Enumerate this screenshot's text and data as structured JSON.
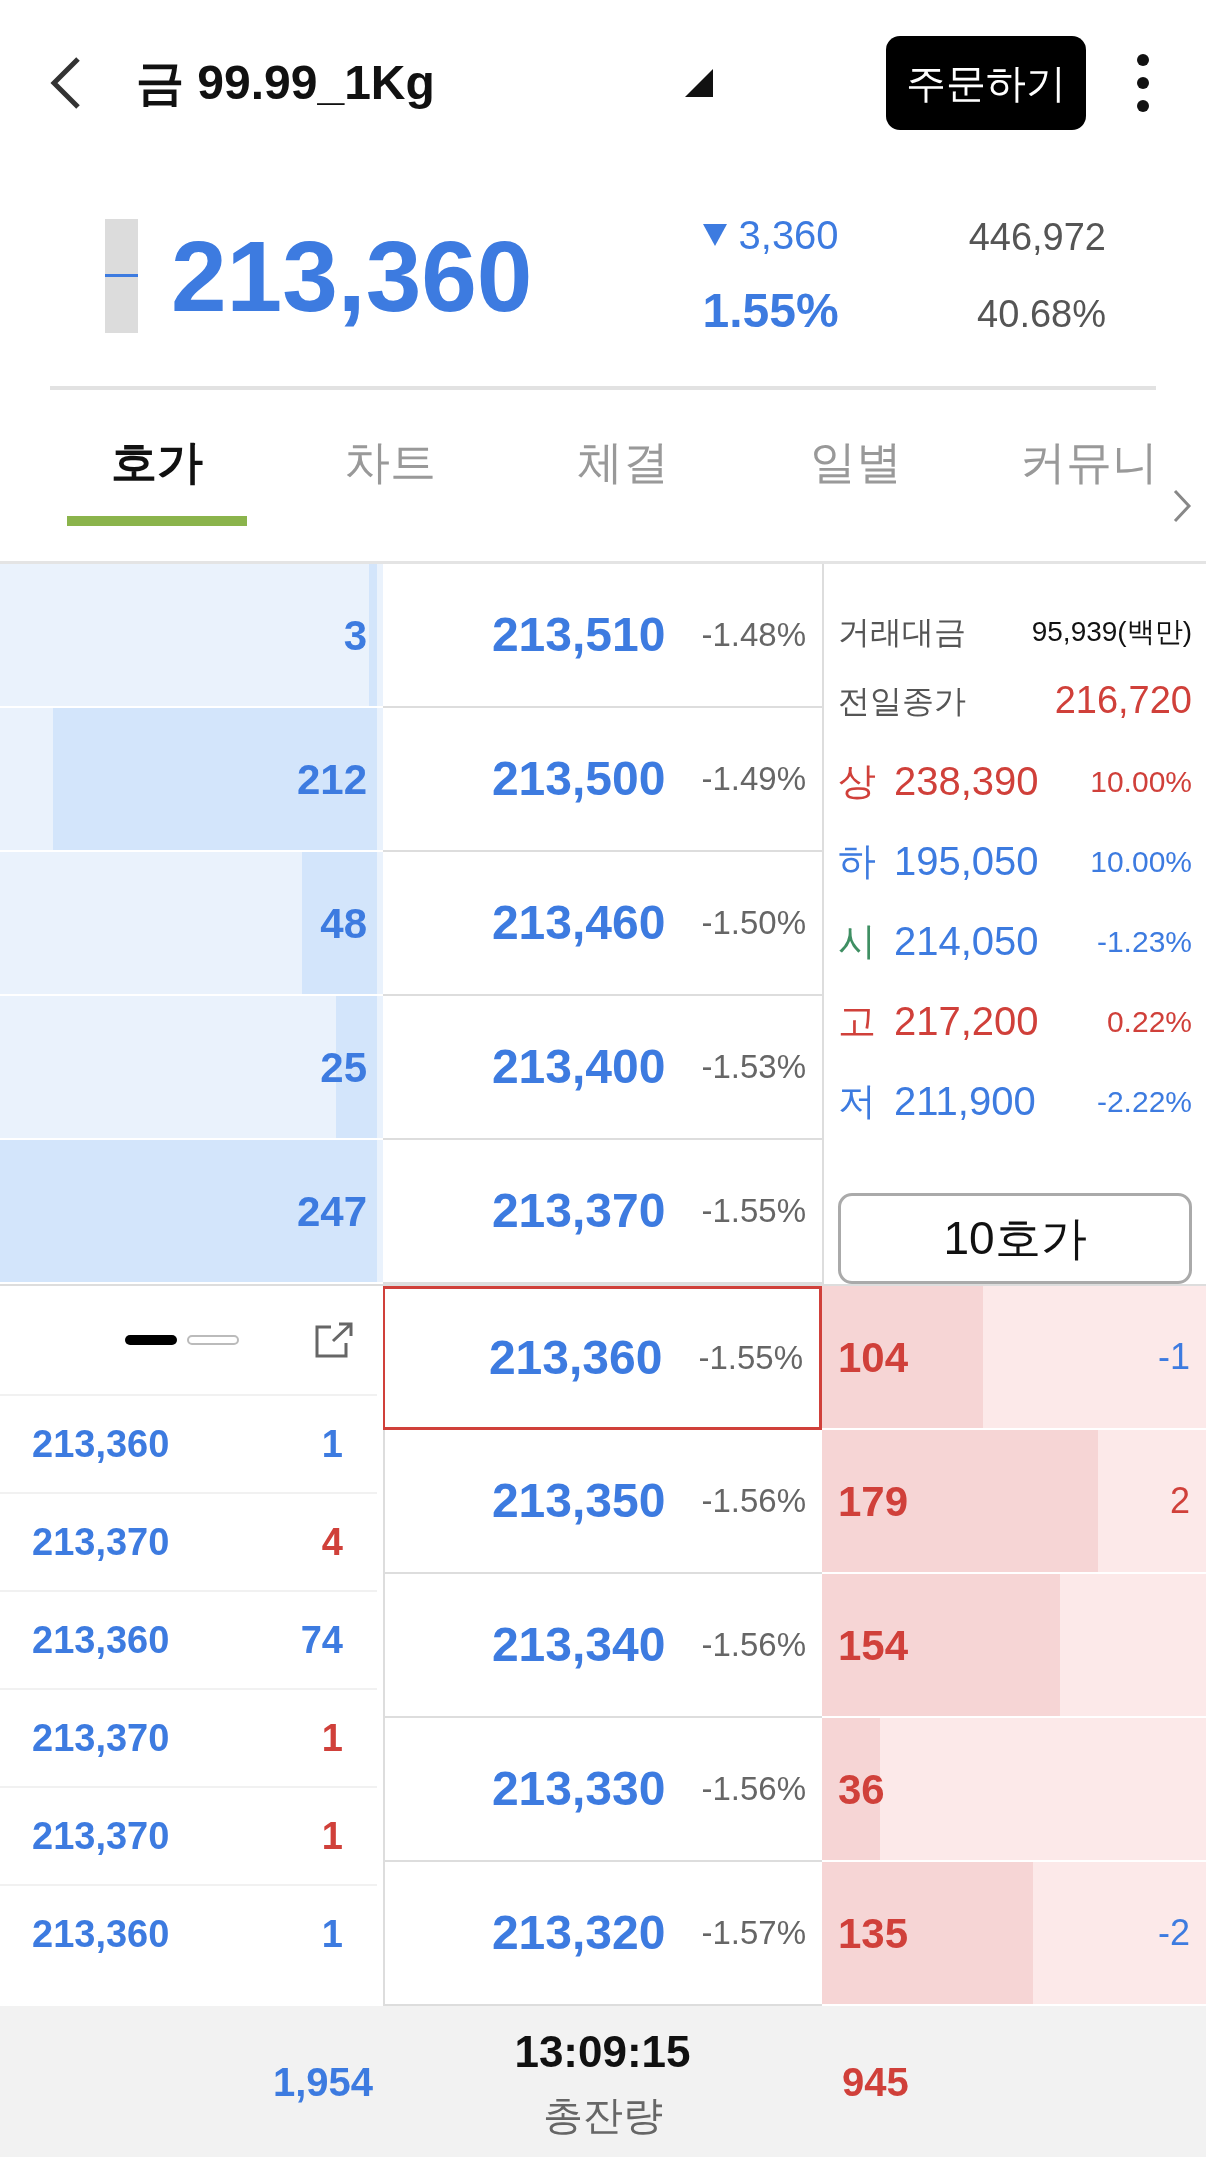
{
  "header": {
    "title": "금 99.99_1Kg",
    "order_button": "주문하기"
  },
  "quote": {
    "price": "213,360",
    "up": false,
    "change": "3,360",
    "change_rate": "1.55%",
    "volume": "446,972",
    "volume_rate": "40.68%"
  },
  "tabs": [
    {
      "label": "호가",
      "selected": true
    },
    {
      "label": "차트",
      "selected": false
    },
    {
      "label": "체결",
      "selected": false
    },
    {
      "label": "일별",
      "selected": false
    },
    {
      "label": "커뮤니",
      "selected": false
    }
  ],
  "asks": [
    {
      "quantity": "3",
      "level": 0.02,
      "price": "213,510",
      "rate": "-1.48%"
    },
    {
      "quantity": "212",
      "level": 0.86,
      "price": "213,500",
      "rate": "-1.49%"
    },
    {
      "quantity": "48",
      "level": 0.2,
      "price": "213,460",
      "rate": "-1.50%"
    },
    {
      "quantity": "25",
      "level": 0.11,
      "price": "213,400",
      "rate": "-1.53%"
    },
    {
      "quantity": "247",
      "level": 1.0,
      "price": "213,370",
      "rate": "-1.55%"
    }
  ],
  "info": {
    "trade_amount_label": "거래대금",
    "trade_amount": "95,939(백만)",
    "prev_close_label": "전일종가",
    "prev_close": "216,720",
    "prices": [
      {
        "label": "상",
        "color": "#d0403a",
        "value": "238,390",
        "rate": "10.00%",
        "up": true
      },
      {
        "label": "하",
        "color": "#3d7be0",
        "value": "195,050",
        "rate": "10.00%",
        "up": false
      },
      {
        "label": "시",
        "color": "#3f8f63",
        "value": "214,050",
        "rate": "-1.23%",
        "up": false
      },
      {
        "label": "고",
        "color": "#d0403a",
        "value": "217,200",
        "rate": "0.22%",
        "up": true
      },
      {
        "label": "저",
        "color": "#3d7be0",
        "value": "211,900",
        "rate": "-2.22%",
        "up": false
      }
    ],
    "depth_button": "10호가"
  },
  "bids": [
    {
      "price": "213,360",
      "rate": "-1.55%",
      "quantity": "104",
      "level": 0.42,
      "change": "-1",
      "up": false,
      "selected": true
    },
    {
      "price": "213,350",
      "rate": "-1.56%",
      "quantity": "179",
      "level": 0.72,
      "change": "2",
      "up": true,
      "selected": false
    },
    {
      "price": "213,340",
      "rate": "-1.56%",
      "quantity": "154",
      "level": 0.62,
      "selected": false
    },
    {
      "price": "213,330",
      "rate": "-1.56%",
      "quantity": "36",
      "level": 0.15,
      "selected": false
    },
    {
      "price": "213,320",
      "rate": "-1.57%",
      "quantity": "135",
      "level": 0.55,
      "change": "-2",
      "up": false,
      "selected": false
    }
  ],
  "ticks": {
    "pages": [
      {
        "selected": true
      },
      {
        "selected": false
      }
    ],
    "rows": [
      {
        "price": "213,360",
        "quantity": "1",
        "buy": false
      },
      {
        "price": "213,370",
        "quantity": "4",
        "buy": true
      },
      {
        "price": "213,360",
        "quantity": "74",
        "buy": false
      },
      {
        "price": "213,370",
        "quantity": "1",
        "buy": true
      },
      {
        "price": "213,370",
        "quantity": "1",
        "buy": true
      },
      {
        "price": "213,360",
        "quantity": "1",
        "buy": false
      }
    ]
  },
  "totals": {
    "ask_total": "1,954",
    "time": "13:09:15",
    "label": "총잔량",
    "bid_total": "945"
  }
}
